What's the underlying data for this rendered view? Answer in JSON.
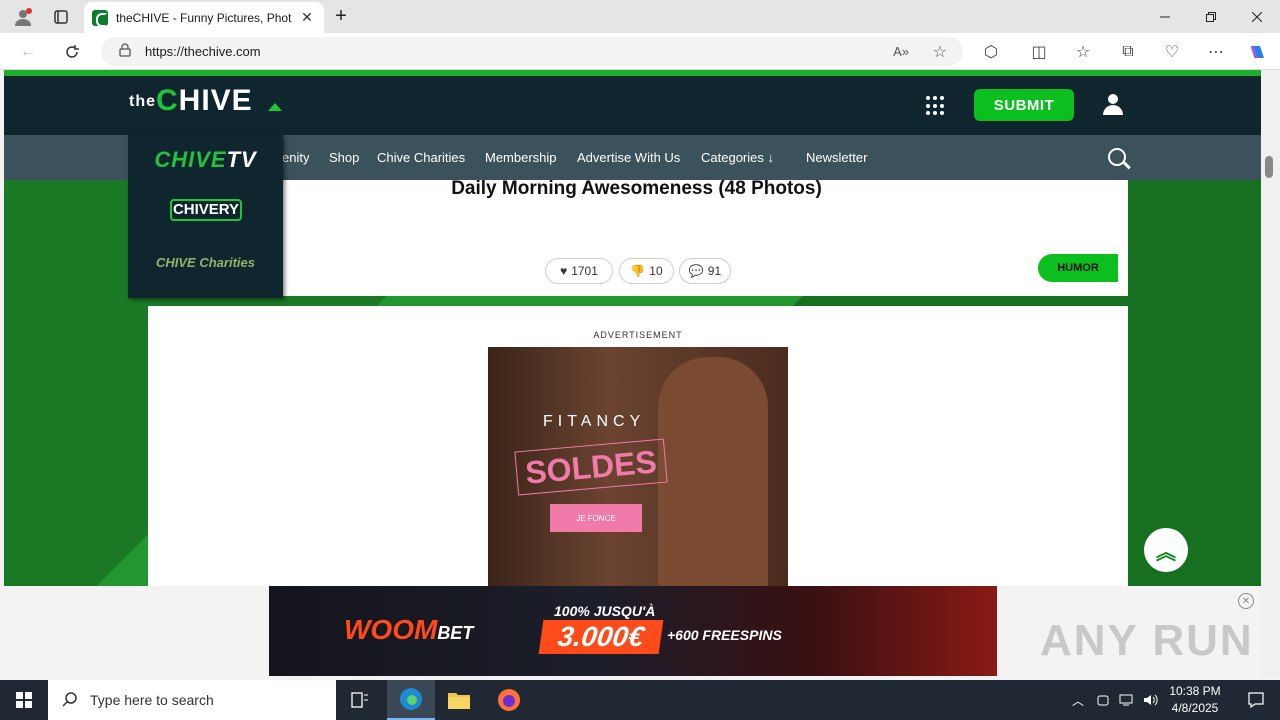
{
  "browser": {
    "tab_title": "theCHIVE - Funny Pictures, Phot",
    "url": "https://thechive.com",
    "new_tab_label": "+"
  },
  "site": {
    "logo": {
      "the": "the",
      "chive": "CHIVE"
    },
    "submit_label": "SUBMIT",
    "nav_items": [
      "enity",
      "Shop",
      "Chive Charities",
      "Membership",
      "Advertise With Us",
      "Categories",
      "Newsletter"
    ],
    "dropdown": {
      "tv": "CHIVE",
      "tv_suffix": "TV",
      "chivery": "CHIVERY",
      "charities": "CHIVE Charities"
    }
  },
  "post": {
    "title": "Daily Morning Awesomeness (48 Photos)",
    "likes": "1701",
    "dislikes": "10",
    "comments": "91",
    "category": "HUMOR"
  },
  "ad": {
    "label": "ADVERTISEMENT",
    "brand": "FITANCY",
    "headline": "SOLDES",
    "cta": "JE FONCE"
  },
  "bottom_ad": {
    "logo": "WOOM",
    "logo_suffix": "BET",
    "line1": "100% JUSQU'À",
    "amount": "3.000€",
    "line2": "+600 FREESPINS",
    "watermark": "ANY RUN"
  },
  "taskbar": {
    "search_placeholder": "Type here to search",
    "time": "10:38 PM",
    "date": "4/8/2025"
  }
}
